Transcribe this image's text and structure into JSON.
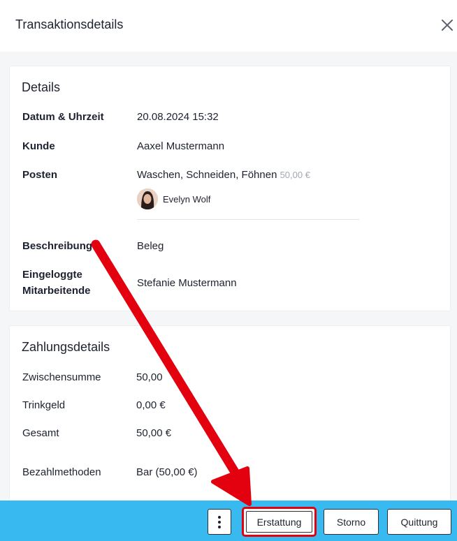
{
  "header": {
    "title": "Transaktionsdetails"
  },
  "details": {
    "title": "Details",
    "rows": {
      "datetime": {
        "label": "Datum & Uhrzeit",
        "value": "20.08.2024 15:32"
      },
      "customer": {
        "label": "Kunde",
        "value": "Aaxel Mustermann"
      },
      "items": {
        "label": "Posten",
        "value": "Waschen, Schneiden, Föhnen",
        "price": "50,00 €",
        "staff": "Evelyn Wolf"
      },
      "description": {
        "label": "Beschreibung",
        "value": "Beleg"
      },
      "logged_in": {
        "label_line1": "Eingeloggte",
        "label_line2": "Mitarbeitende",
        "value": "Stefanie Mustermann"
      }
    }
  },
  "payment": {
    "title": "Zahlungsdetails",
    "subtotal": {
      "label": "Zwischensumme",
      "value": "50,00"
    },
    "tip": {
      "label": "Trinkgeld",
      "value": "0,00 €"
    },
    "total": {
      "label": "Gesamt",
      "value": "50,00 €"
    },
    "methods": {
      "label": "Bezahlmethoden",
      "value": "Bar (50,00 €)"
    }
  },
  "footer": {
    "more_icon": "vertical-dots-icon",
    "refund_label": "Erstattung",
    "storno_label": "Storno",
    "receipt_label": "Quittung"
  },
  "colors": {
    "footer_bg": "#38b9f0",
    "highlight": "#e3000f",
    "muted_text": "#a3a7b2"
  }
}
